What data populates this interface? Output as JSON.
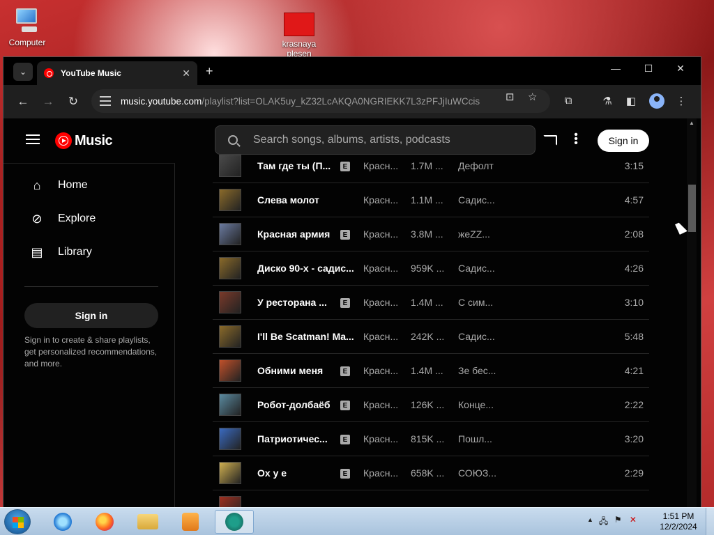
{
  "desktop": {
    "icons": [
      {
        "label": "Computer"
      },
      {
        "label": "krasnaya plesen"
      }
    ]
  },
  "browser": {
    "tab": {
      "title": "YouTube Music",
      "close": "✕"
    },
    "new_tab": "+",
    "window_controls": {
      "minimize": "—",
      "maximize": "☐",
      "close": "✕"
    },
    "url": {
      "domain": "music.youtube.com",
      "path": "/playlist?list=OLAK5uy_kZ32LcAKQA0NGRIEKK7L3zPFJjIuWCcis"
    },
    "icons": [
      "back-icon",
      "forward-icon",
      "reload-icon",
      "site-info-icon",
      "install-app-icon",
      "bookmark-star-icon",
      "extensions-icon",
      "labs-icon",
      "side-panel-icon",
      "profile-icon",
      "menu-icon"
    ]
  },
  "ytm": {
    "logo_text": "Music",
    "search_placeholder": "Search songs, albums, artists, podcasts",
    "sign_in": "Sign in",
    "sidebar": {
      "items": [
        {
          "label": "Home",
          "icon": "home-icon"
        },
        {
          "label": "Explore",
          "icon": "compass-icon"
        },
        {
          "label": "Library",
          "icon": "library-icon"
        }
      ],
      "sign_in": "Sign in",
      "sign_in_text": "Sign in to create & share playlists, get personalized recommendations, and more."
    },
    "explicit_badge": "E",
    "tracks": [
      {
        "title": "Там где ты (П...",
        "explicit": true,
        "artist": "Красн...",
        "plays": "1.7M ...",
        "album": "Дефолт",
        "duration": "3:15",
        "thumb": "#4a4a4a"
      },
      {
        "title": "Слева молот",
        "explicit": false,
        "artist": "Красн...",
        "plays": "1.1M ...",
        "album": "Садис...",
        "duration": "4:57",
        "thumb": "#8a6a2a"
      },
      {
        "title": "Красная армия",
        "explicit": true,
        "artist": "Красн...",
        "plays": "3.8M ...",
        "album": "жеZZ...",
        "duration": "2:08",
        "thumb": "#6a7aa0"
      },
      {
        "title": "Диско 90-х - садис...",
        "explicit": false,
        "artist": "Красн...",
        "plays": "959K ...",
        "album": "Садис...",
        "duration": "4:26",
        "thumb": "#8a6a2a"
      },
      {
        "title": "У ресторана ...",
        "explicit": true,
        "artist": "Красн...",
        "plays": "1.4M ...",
        "album": "С сим...",
        "duration": "3:10",
        "thumb": "#7a3a2a"
      },
      {
        "title": "I'll Be Scatman! Ma...",
        "explicit": false,
        "artist": "Красн...",
        "plays": "242K ...",
        "album": "Садис...",
        "duration": "5:48",
        "thumb": "#8a6a2a"
      },
      {
        "title": "Обними меня",
        "explicit": true,
        "artist": "Красн...",
        "plays": "1.4M ...",
        "album": "Зе бес...",
        "duration": "4:21",
        "thumb": "#c0502a"
      },
      {
        "title": "Робот-долбаёб",
        "explicit": true,
        "artist": "Красн...",
        "plays": "126K ...",
        "album": "Конце...",
        "duration": "2:22",
        "thumb": "#5a8aa0"
      },
      {
        "title": "Патриотичес...",
        "explicit": true,
        "artist": "Красн...",
        "plays": "815K ...",
        "album": "Пошл...",
        "duration": "3:20",
        "thumb": "#3a6ac0"
      },
      {
        "title": "Ох у е",
        "explicit": true,
        "artist": "Красн...",
        "plays": "658K ...",
        "album": "СОЮЗ...",
        "duration": "2:29",
        "thumb": "#d0b050"
      },
      {
        "title": "",
        "explicit": false,
        "artist": "",
        "plays": "",
        "album": "",
        "duration": "",
        "thumb": "#a03020"
      }
    ]
  },
  "taskbar": {
    "apps": [
      "internet-explorer-icon",
      "firefox-icon",
      "file-explorer-icon",
      "media-player-icon",
      "active-app-icon"
    ],
    "clock": {
      "time": "1:51 PM",
      "date": "12/2/2024"
    },
    "tray_arrow": "▲"
  }
}
